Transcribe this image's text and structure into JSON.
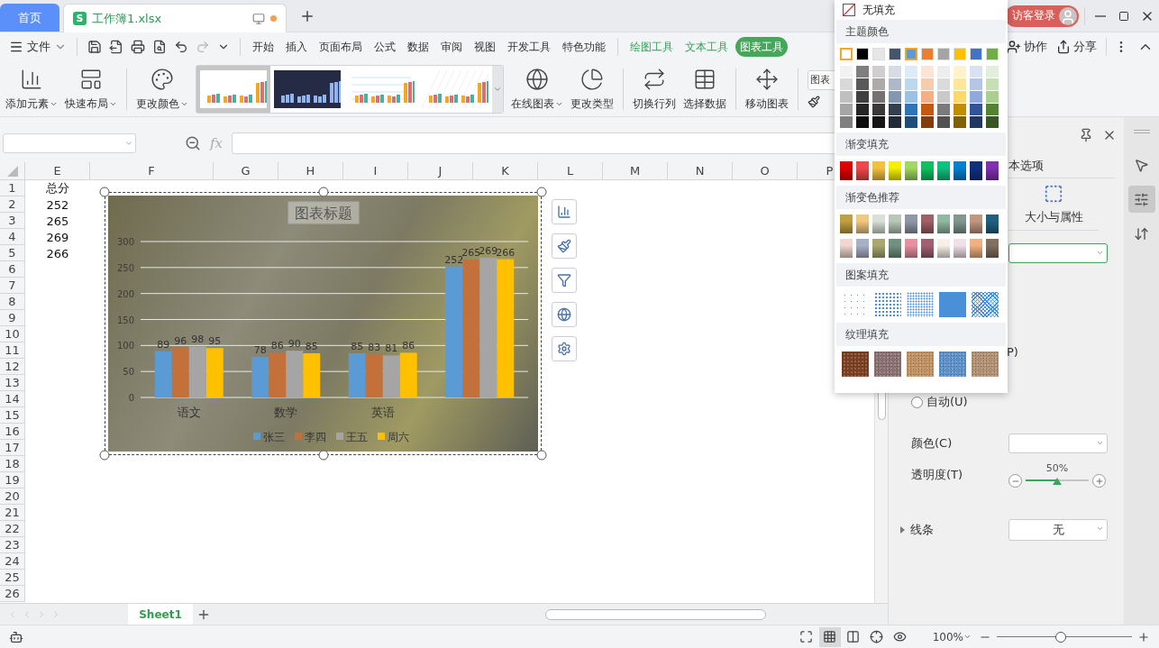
{
  "title_bar": {
    "home_tab": "首页",
    "document": {
      "logo": "S",
      "title": "工作簿1.xlsx",
      "unsaved": true
    },
    "login": "访客登录"
  },
  "menu_bar": {
    "file": "文件",
    "tabs": [
      {
        "label": "开始",
        "kind": "main",
        "selected": false
      },
      {
        "label": "插入",
        "kind": "main",
        "selected": false
      },
      {
        "label": "页面布局",
        "kind": "main",
        "selected": false
      },
      {
        "label": "公式",
        "kind": "main",
        "selected": false
      },
      {
        "label": "数据",
        "kind": "main",
        "selected": false
      },
      {
        "label": "审阅",
        "kind": "main",
        "selected": false
      },
      {
        "label": "视图",
        "kind": "main",
        "selected": false
      },
      {
        "label": "开发工具",
        "kind": "main",
        "selected": false
      },
      {
        "label": "特色功能",
        "kind": "main",
        "selected": false
      },
      {
        "label": "绘图工具",
        "kind": "context",
        "selected": false
      },
      {
        "label": "文本工具",
        "kind": "context",
        "selected": false
      },
      {
        "label": "图表工具",
        "kind": "context",
        "selected": true
      }
    ],
    "actions": [
      "协作",
      "分享"
    ]
  },
  "ribbon": {
    "items": [
      {
        "kind": "button",
        "label": "添加元素",
        "dropdown": true
      },
      {
        "kind": "button",
        "label": "快速布局",
        "dropdown": true,
        "divider_after": true
      },
      {
        "kind": "button",
        "label": "更改颜色",
        "dropdown": true
      },
      {
        "kind": "gallery",
        "styles": [
          {
            "kind": "light",
            "selected": true
          },
          {
            "kind": "dark",
            "selected": false
          },
          {
            "kind": "grid",
            "selected": false
          },
          {
            "kind": "striped",
            "selected": false
          }
        ]
      },
      {
        "kind": "button",
        "label": "在线图表",
        "dropdown": true
      },
      {
        "kind": "button",
        "label": "更改类型",
        "divider_after": true
      },
      {
        "kind": "button",
        "label": "切换行列"
      },
      {
        "kind": "button",
        "label": "选择数据",
        "divider_after": true
      },
      {
        "kind": "button",
        "label": "移动图表",
        "divider_after": true
      },
      {
        "kind": "selector",
        "label": "图表"
      }
    ]
  },
  "formula_bar": {
    "function_label": "fx"
  },
  "sheet": {
    "columns": [
      "E",
      "F",
      "G",
      "H",
      "I",
      "J",
      "K",
      "L",
      "M",
      "N",
      "O",
      "P"
    ],
    "rows": [
      {
        "header": "1",
        "cells": [
          "总分"
        ]
      },
      {
        "header": "2",
        "cells": [
          "252"
        ]
      },
      {
        "header": "3",
        "cells": [
          "265"
        ]
      },
      {
        "header": "4",
        "cells": [
          "269"
        ]
      },
      {
        "header": "5",
        "cells": [
          "266"
        ]
      },
      {
        "header": "6"
      },
      {
        "header": "7"
      },
      {
        "header": "8"
      },
      {
        "header": "9"
      },
      {
        "header": "10"
      },
      {
        "header": "11"
      },
      {
        "header": "12"
      },
      {
        "header": "13"
      },
      {
        "header": "14"
      },
      {
        "header": "15"
      },
      {
        "header": "16"
      },
      {
        "header": "17"
      },
      {
        "header": "18"
      },
      {
        "header": "19"
      },
      {
        "header": "20"
      },
      {
        "header": "21"
      },
      {
        "header": "22"
      },
      {
        "header": "23"
      },
      {
        "header": "24"
      },
      {
        "header": "25"
      },
      {
        "header": "26"
      }
    ],
    "chart": {
      "chart_data": {
        "type": "bar",
        "title": "图表标题",
        "categories": [
          "语文",
          "数学",
          "英语",
          null
        ],
        "series": [
          {
            "name": "张三",
            "color": "#5b9bd5",
            "values": [
              89,
              78,
              85,
              252
            ]
          },
          {
            "name": "李四",
            "color": "#c4703a",
            "values": [
              96,
              86,
              83,
              265
            ]
          },
          {
            "name": "王五",
            "color": "#a5a5a5",
            "values": [
              98,
              90,
              81,
              269
            ]
          },
          {
            "name": "周六",
            "color": "#ffc000",
            "values": [
              95,
              85,
              86,
              266
            ]
          }
        ],
        "ylim": [
          0,
          300
        ],
        "yticks": [
          0,
          50,
          100,
          150,
          200,
          250,
          300
        ],
        "data_labels": true,
        "grid": true,
        "legend": true
      }
    }
  },
  "sheet_tabs": [
    {
      "label": "Sheet1",
      "selected": true
    }
  ],
  "panel": {
    "partial_tab": "本选项",
    "size_tab": "大小与属性",
    "partial_label": "P)",
    "auto_radio": {
      "label": "自动(U)",
      "selected": false
    },
    "color_label": "颜色(C)",
    "transparency": {
      "label": "透明度(T)",
      "reading": "50%",
      "level": 0.5
    },
    "line": {
      "label": "线条",
      "value": "无",
      "expanded": false
    }
  },
  "side_strip": [
    {
      "selected": false
    },
    {
      "selected": true
    },
    {
      "selected": false
    }
  ],
  "status_bar": {
    "views": [
      {
        "selected": false
      },
      {
        "selected": true
      },
      {
        "selected": false
      },
      {
        "selected": false
      },
      {
        "selected": false
      }
    ],
    "zoom": "100%",
    "zoom_slider": {
      "level": 0.47
    }
  },
  "fill_menu": {
    "no_fill": "无填充",
    "theme_title": "主题颜色",
    "theme_colors": [
      {
        "color": "#ffffff",
        "selected": true,
        "shades": [
          {
            "color": "#f2f2f2"
          },
          {
            "color": "#d9d9d9"
          },
          {
            "color": "#bfbfbf"
          },
          {
            "color": "#a6a6a6"
          },
          {
            "color": "#808080"
          }
        ]
      },
      {
        "color": "#000000",
        "selected": false,
        "shades": [
          {
            "color": "#7f7f7f"
          },
          {
            "color": "#595959"
          },
          {
            "color": "#404040"
          },
          {
            "color": "#262626"
          },
          {
            "color": "#0d0d0d"
          }
        ]
      },
      {
        "color": "#e7e6e6",
        "selected": false,
        "shades": [
          {
            "color": "#d0cece"
          },
          {
            "color": "#aeaaaa"
          },
          {
            "color": "#757171"
          },
          {
            "color": "#3a3838"
          },
          {
            "color": "#171616"
          }
        ]
      },
      {
        "color": "#44546a",
        "selected": false,
        "shades": [
          {
            "color": "#d6dce4"
          },
          {
            "color": "#adb9ca"
          },
          {
            "color": "#8497b0"
          },
          {
            "color": "#333f4f"
          },
          {
            "color": "#222b35"
          }
        ]
      },
      {
        "color": "#5b9bd5",
        "selected": true,
        "shades": [
          {
            "color": "#ddebf7"
          },
          {
            "color": "#bdd7ee"
          },
          {
            "color": "#9bc2e6"
          },
          {
            "color": "#2f75b5"
          },
          {
            "color": "#1f4e78"
          }
        ]
      },
      {
        "color": "#ed7d31",
        "selected": false,
        "shades": [
          {
            "color": "#fce4d6"
          },
          {
            "color": "#f8cbad"
          },
          {
            "color": "#f4b084"
          },
          {
            "color": "#c65911"
          },
          {
            "color": "#833c0c"
          }
        ]
      },
      {
        "color": "#a5a5a5",
        "selected": false,
        "shades": [
          {
            "color": "#ededed"
          },
          {
            "color": "#dbdbdb"
          },
          {
            "color": "#c9c9c9"
          },
          {
            "color": "#7b7b7b"
          },
          {
            "color": "#525252"
          }
        ]
      },
      {
        "color": "#ffc000",
        "selected": false,
        "shades": [
          {
            "color": "#fff2cc"
          },
          {
            "color": "#ffe699"
          },
          {
            "color": "#ffd966"
          },
          {
            "color": "#bf8f00"
          },
          {
            "color": "#806000"
          }
        ]
      },
      {
        "color": "#4472c4",
        "selected": false,
        "shades": [
          {
            "color": "#d9e1f2"
          },
          {
            "color": "#b4c6e7"
          },
          {
            "color": "#8ea9db"
          },
          {
            "color": "#305496"
          },
          {
            "color": "#203764"
          }
        ]
      },
      {
        "color": "#70ad47",
        "selected": false,
        "shades": [
          {
            "color": "#e2efda"
          },
          {
            "color": "#c6e0b4"
          },
          {
            "color": "#a9d08e"
          },
          {
            "color": "#548235"
          },
          {
            "color": "#375623"
          }
        ]
      }
    ],
    "gradient_title": "渐变填充",
    "gradients": [
      {
        "color": "#e00000"
      },
      {
        "color": "#f04848"
      },
      {
        "color": "#f5c040"
      },
      {
        "color": "#f5f000"
      },
      {
        "color": "#a0d860"
      },
      {
        "color": "#10c060"
      },
      {
        "color": "#10c080"
      },
      {
        "color": "#0080d0"
      },
      {
        "color": "#103080"
      },
      {
        "color": "#8030b0"
      }
    ],
    "recommended_title": "渐变色推荐",
    "recommended": [
      {
        "color": "#c0a040"
      },
      {
        "color": "#f0c880"
      },
      {
        "color": "#d8e0d8"
      },
      {
        "color": "#b8c8b8"
      },
      {
        "color": "#9098a8"
      },
      {
        "color": "#a06068"
      },
      {
        "color": "#90b8a0"
      },
      {
        "color": "#809890"
      },
      {
        "color": "#c09880"
      },
      {
        "color": "#206080"
      },
      {
        "color": "#f0d8d0"
      },
      {
        "color": "#a8b0c8"
      },
      {
        "color": "#a8a870"
      },
      {
        "color": "#709080"
      },
      {
        "color": "#e890a0"
      },
      {
        "color": "#a06070"
      },
      {
        "color": "#f8f0e8"
      },
      {
        "color": "#f0e0e8"
      },
      {
        "color": "#f0b080"
      },
      {
        "color": "#807060"
      }
    ],
    "pattern_title": "图案填充",
    "patterns": [
      {
        "kind": "sparse"
      },
      {
        "kind": "light"
      },
      {
        "kind": "medium"
      },
      {
        "kind": "dense"
      },
      {
        "kind": "grid"
      }
    ],
    "texture_title": "纹理填充",
    "textures": [
      {
        "color": "#7a4020"
      },
      {
        "color": "#8a7070"
      },
      {
        "color": "#c09060"
      },
      {
        "color": "#5b90c8"
      },
      {
        "color": "#b09070"
      }
    ]
  }
}
